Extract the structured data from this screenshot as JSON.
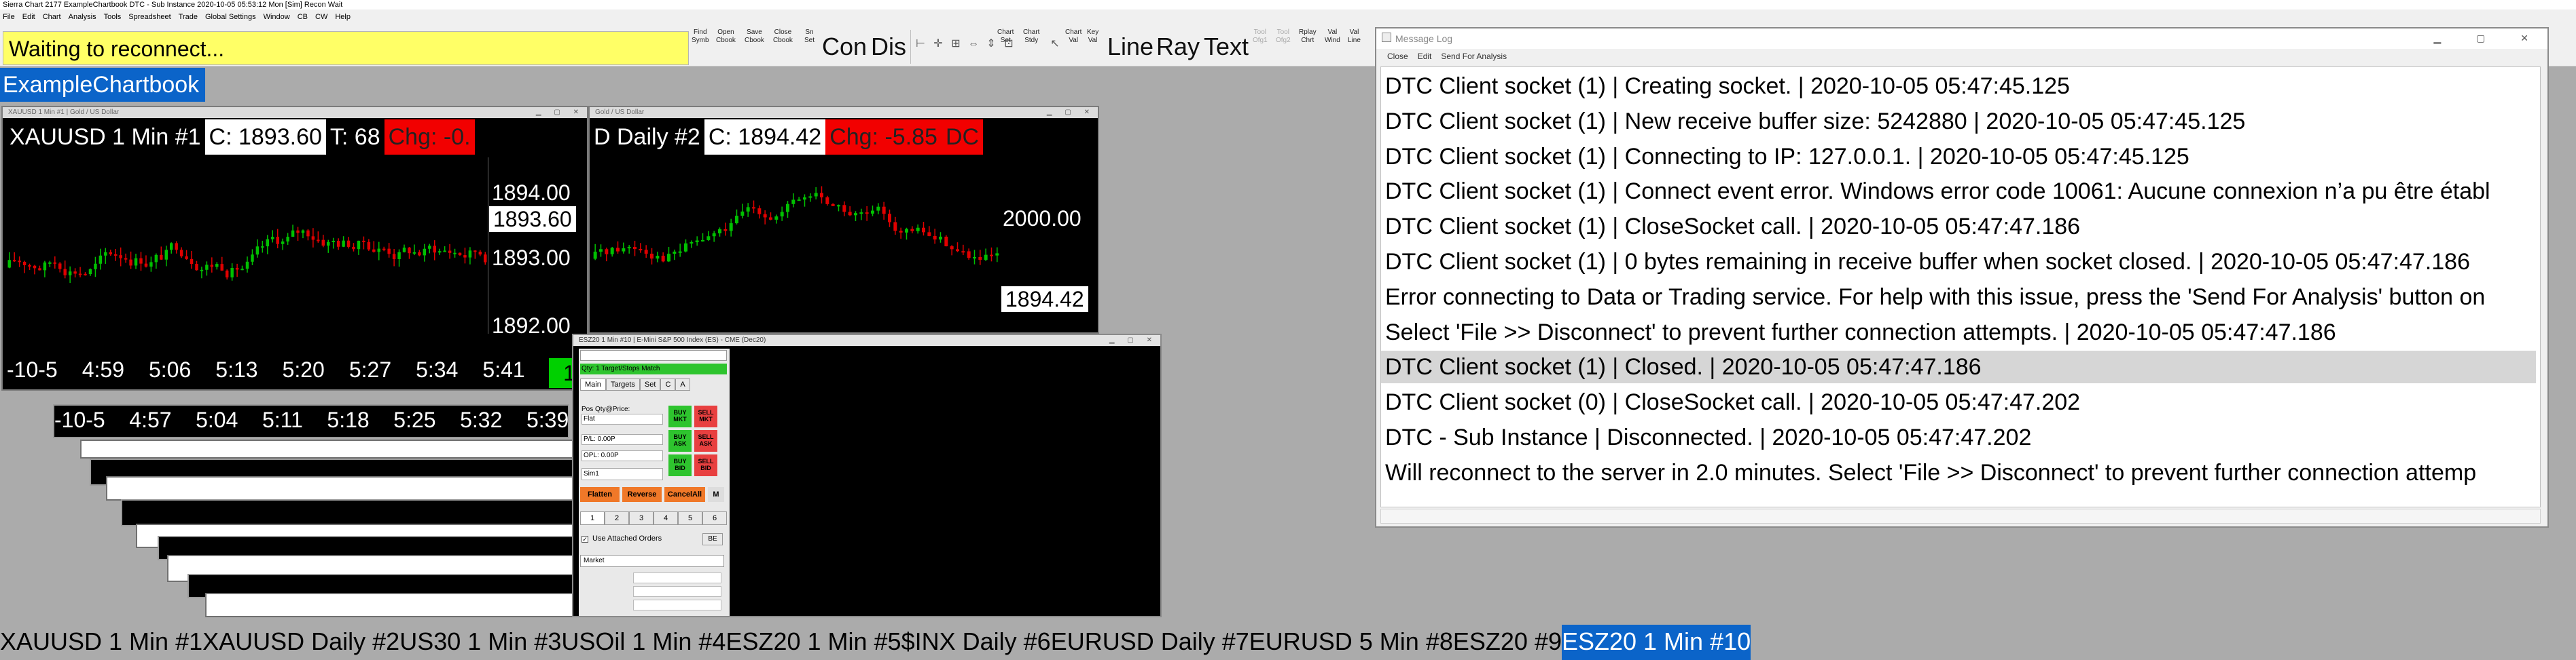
{
  "app": {
    "title": "Sierra Chart 2177 ExampleChartbook  DTC - Sub Instance 2020-10-05  05:53:12 Mon [Sim]  Recon Wait"
  },
  "menu": [
    "File",
    "Edit",
    "Chart",
    "Analysis",
    "Tools",
    "Spreadsheet",
    "Trade",
    "Global Settings",
    "Window",
    "CB",
    "CW",
    "Help"
  ],
  "toolbar": {
    "status": "Waiting to reconnect...",
    "small_buttons": [
      {
        "label": "Find\nSymb",
        "name": "find-symbol-button"
      },
      {
        "label": "Open\nCbook",
        "name": "open-chartbook-button"
      },
      {
        "label": "Save\nCbook",
        "name": "save-chartbook-button"
      },
      {
        "label": "Close\nCbook",
        "name": "close-chartbook-button"
      },
      {
        "label": "Sn\nSet",
        "name": "sn-set-button"
      }
    ],
    "con": "Con",
    "dis": "Dis",
    "chart_buttons": [
      {
        "label": "Chart\nSet",
        "name": "chart-set-button"
      },
      {
        "label": "Chart\nStdy",
        "name": "chart-study-button"
      }
    ],
    "chart_val": "Chart\nVal",
    "key_val": "Key\nVal",
    "line": "Line",
    "ray": "Ray",
    "text": "Text",
    "tool_buttons": [
      {
        "label": "Tool\nOfg1",
        "name": "tool-ofg1-button"
      },
      {
        "label": "Tool\nOfg2",
        "name": "tool-ofg2-button"
      },
      {
        "label": "Rplay\nChrt",
        "name": "replay-chart-button"
      },
      {
        "label": "Val\nWind",
        "name": "value-window-button"
      },
      {
        "label": "Val\nLine",
        "name": "value-line-button"
      }
    ]
  },
  "chartbook_tab": "ExampleChartbook",
  "chart1": {
    "title": "XAUUSD  1 Min  #1 | Gold / US Dollar",
    "symbol": "XAUUSD  1 Min   #1",
    "close": "C: 1893.60",
    "ticks": "T: 68",
    "change": "Chg: -0.",
    "prices": [
      "1894.00",
      "1893.60",
      "1893.00",
      "1892.00"
    ],
    "times": [
      "-10-5",
      "4:59",
      "5:06",
      "5:13",
      "5:20",
      "5:27",
      "5:34",
      "5:41"
    ],
    "green_tag": "1"
  },
  "chart2": {
    "title": "Gold / US Dollar",
    "symbol": "D  Daily   #2",
    "close": "C: 1894.42",
    "change": "Chg: -5.85",
    "extra": "DC",
    "prices": [
      "2000.00",
      "1894.42"
    ]
  },
  "stacked_chart": {
    "times": [
      "-10-5",
      "4:57",
      "5:04",
      "5:11",
      "5:18",
      "5:25",
      "5:32",
      "5:39"
    ]
  },
  "trade_window": {
    "title": "ESZ20  1 Min  #10 | E-Mini S&P 500 Index (ES) - CME (Dec20)",
    "qty_line": "Qty: 1 Target/Stops Match",
    "tabs": [
      "Main",
      "Targets",
      "Set",
      "C",
      "A"
    ],
    "pos_label": "Pos Qty@Price:",
    "pos_value": "Flat",
    "pl": "P/L: 0.00P",
    "opl": "OPL: 0.00P",
    "account": "Sim1",
    "buy_mkt": "BUY\nMKT",
    "sell_mkt": "SELL\nMKT",
    "buy_ask": "BUY\nASK",
    "sell_ask": "SELL\nASK",
    "buy_bid": "BUY\nBID",
    "sell_bid": "SELL\nBID",
    "flatten": "Flatten",
    "reverse": "Reverse",
    "cancel_all": "CancelAll",
    "m": "M",
    "qty_presets": [
      "1",
      "2",
      "3",
      "4",
      "5",
      "6"
    ],
    "attached_orders": "Use Attached Orders",
    "be": "BE",
    "order_type": "Market"
  },
  "message_log": {
    "title": "Message Log",
    "menu": [
      "Close",
      "Edit",
      "Send For Analysis"
    ],
    "lines": [
      "DTC Client socket (1) | Creating socket. | 2020-10-05  05:47:45.125",
      "DTC Client socket (1) | New receive buffer size: 5242880 | 2020-10-05  05:47:45.125",
      "DTC Client socket (1) | Connecting to IP: 127.0.0.1. | 2020-10-05  05:47:45.125",
      "DTC Client socket (1) | Connect event error. Windows error code 10061: Aucune connexion n’a pu être établ",
      "DTC Client socket (1) | CloseSocket call. | 2020-10-05  05:47:47.186",
      "DTC Client socket (1) | 0 bytes remaining in receive buffer when socket closed. | 2020-10-05  05:47:47.186",
      "Error connecting to Data or Trading service.  For help with this issue, press the 'Send For Analysis' button on",
      "Select 'File >> Disconnect' to prevent further connection attempts. | 2020-10-05  05:47:47.186",
      "DTC Client socket (1) | Closed. | 2020-10-05  05:47:47.186",
      "DTC Client socket (0) | CloseSocket call. | 2020-10-05  05:47:47.202",
      "DTC - Sub Instance | Disconnected. | 2020-10-05  05:47:47.202",
      "Will reconnect to the server in 2.0 minutes. Select 'File >> Disconnect' to prevent further connection attemp"
    ],
    "selected_index": 8
  },
  "bottom_tabs": [
    "XAUUSD  1 Min   #1",
    "XAUUSD  Daily  #2",
    "US30  1 Min   #3",
    "USOil  1 Min   #4",
    "ESZ20  1 Min   #5",
    "$INX  Daily  #6",
    "EURUSD  Daily  #7",
    "EURUSD  5 Min   #8",
    "ESZ20  #9",
    "ESZ20  1 Min   #10"
  ],
  "active_bottom_tab": 9,
  "colors": {
    "status_bg": "#ffff66",
    "accent": "#0b64c9",
    "up": "#00c000",
    "down": "#e00000"
  },
  "chart_data": [
    {
      "type": "candlestick",
      "symbol": "XAUUSD 1 Min",
      "x_ticks": [
        "-10-5",
        "4:59",
        "5:06",
        "5:13",
        "5:20",
        "5:27",
        "5:34",
        "5:41"
      ],
      "y_ticks": [
        "1894.00",
        "1893.00",
        "1892.00"
      ],
      "last": 1893.6,
      "ylim": [
        1891.8,
        1894.4
      ]
    },
    {
      "type": "candlestick",
      "symbol": "XAUUSD Daily",
      "y_ticks": [
        "2000.00"
      ],
      "last": 1894.42
    }
  ]
}
